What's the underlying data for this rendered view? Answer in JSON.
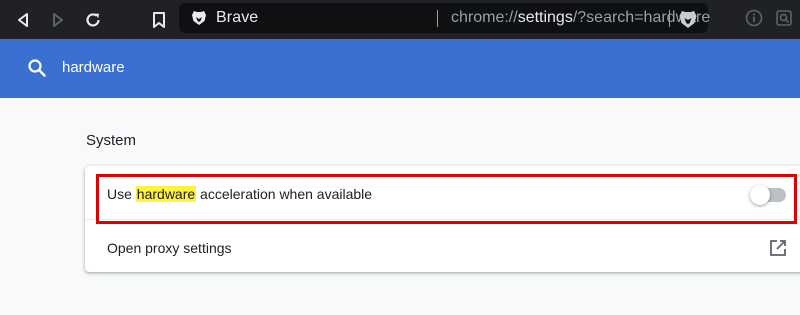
{
  "toolbar": {
    "back_icon": "back-arrow-icon",
    "forward_icon": "forward-arrow-icon",
    "reload_icon": "reload-icon",
    "bookmark_icon": "bookmark-icon",
    "site_name": "Brave",
    "url_prefix": "chrome://",
    "url_highlight": "settings",
    "url_suffix": "/?search=hardware",
    "shields_icon": "brave-shields-icon"
  },
  "search": {
    "icon": "search-icon",
    "value": "hardware"
  },
  "section": {
    "title": "System"
  },
  "settings": {
    "hw_accel_prefix": "Use ",
    "hw_accel_match": "hardware",
    "hw_accel_suffix": " acceleration when available",
    "hw_accel_enabled": false,
    "proxy_label": "Open proxy settings"
  },
  "colors": {
    "header_blue": "#3c6fd2",
    "toolbar_dark": "#202124",
    "highlight_yellow": "#fff142",
    "annotation_red": "#e00000"
  }
}
